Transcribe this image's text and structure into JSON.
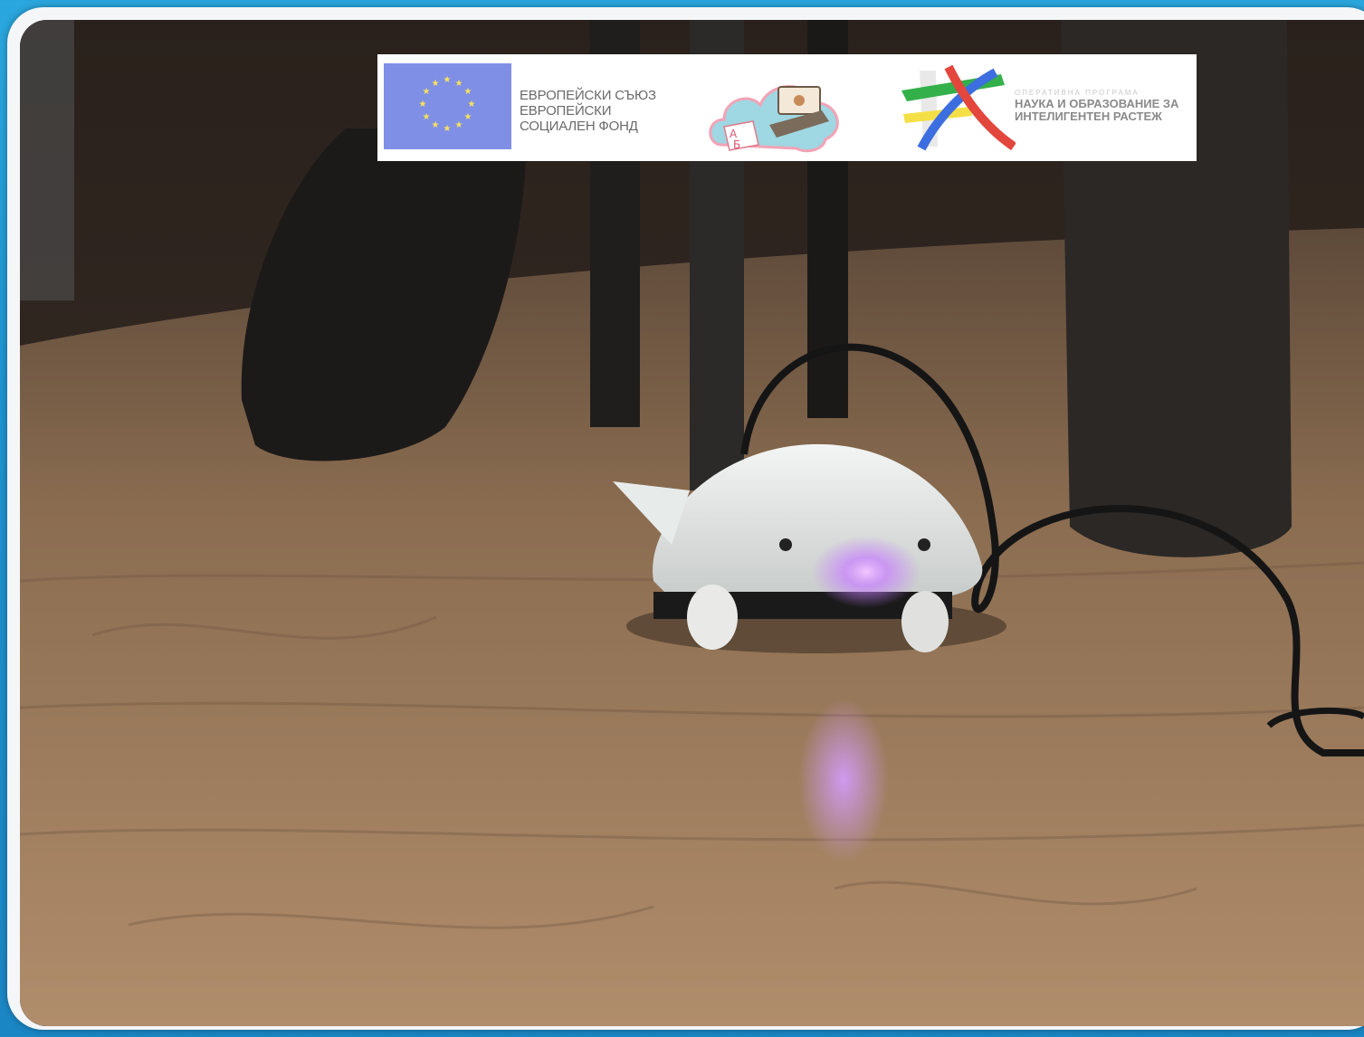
{
  "banner": {
    "eu_text": [
      "ЕВРОПЕЙСКИ СЪЮЗ",
      "ЕВРОПЕЙСКИ",
      "СОЦИАЛЕН ФОНД"
    ],
    "op_kicker": "ОПЕРАТИВНА ПРОГРАМА",
    "op_lines": [
      "НАУКА И ОБРАЗОВАНИЕ ЗА",
      "ИНТЕЛИГЕНТЕН РАСТЕЖ"
    ],
    "cloud_letters": [
      "А",
      "Б"
    ]
  },
  "photo": {
    "subject": "robot-icon",
    "light_color": "#c77dff"
  },
  "colors": {
    "frame_blue": "#2aa7de",
    "eu_blue": "#7f8fe6",
    "eu_star": "#f7e35a",
    "floor": "#a4805e"
  }
}
